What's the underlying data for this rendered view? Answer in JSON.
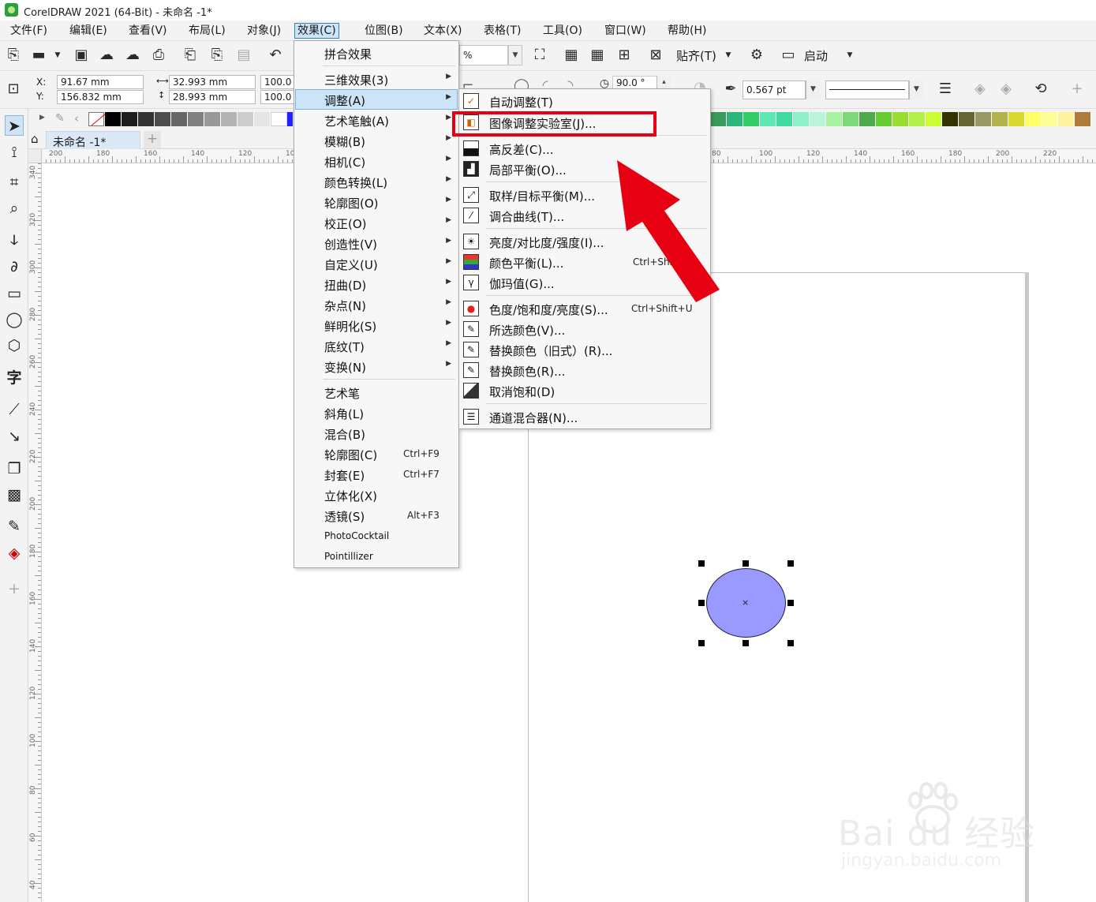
{
  "window": {
    "title": "CorelDRAW 2021 (64-Bit) - 未命名 -1*"
  },
  "menubar": {
    "items": [
      "文件(F)",
      "编辑(E)",
      "查看(V)",
      "布局(L)",
      "对象(J)",
      "效果(C)",
      "位图(B)",
      "文本(X)",
      "表格(T)",
      "工具(O)",
      "窗口(W)",
      "帮助(H)"
    ],
    "active": "效果(C)"
  },
  "toolbar": {
    "zoom_suffix": "%",
    "snap_label": "贴齐(T)",
    "launch_label": "启动"
  },
  "propbar": {
    "x_label": "X:",
    "x_value": "91.67 mm",
    "y_label": "Y:",
    "y_value": "156.832 mm",
    "w_value": "32.993 mm",
    "h_value": "28.993 mm",
    "scale_w": "100.0",
    "scale_h": "100.0",
    "angle_value": "90.0 °",
    "outline_width": "0.567 pt"
  },
  "doc_tab": {
    "label": "未命名 -1*"
  },
  "hruler_labels": [
    "200",
    "180",
    "160",
    "140",
    "120",
    "10",
    "80",
    "100",
    "120",
    "140",
    "160",
    "180",
    "200",
    "220"
  ],
  "vruler_labels": [
    "340",
    "320",
    "300",
    "280",
    "260",
    "240",
    "220",
    "200",
    "180",
    "160",
    "140",
    "120",
    "100",
    "80",
    "60",
    "40"
  ],
  "effects_menu": {
    "items": [
      {
        "label": "拼合效果",
        "shortcut": "",
        "submenu": false
      },
      {
        "label": "三维效果(3)",
        "shortcut": "",
        "submenu": true
      },
      {
        "label": "调整(A)",
        "shortcut": "",
        "submenu": true
      },
      {
        "label": "艺术笔触(A)",
        "shortcut": "",
        "submenu": true
      },
      {
        "label": "模糊(B)",
        "shortcut": "",
        "submenu": true
      },
      {
        "label": "相机(C)",
        "shortcut": "",
        "submenu": true
      },
      {
        "label": "颜色转换(L)",
        "shortcut": "",
        "submenu": true
      },
      {
        "label": "轮廓图(O)",
        "shortcut": "",
        "submenu": true
      },
      {
        "label": "校正(O)",
        "shortcut": "",
        "submenu": true
      },
      {
        "label": "创造性(V)",
        "shortcut": "",
        "submenu": true
      },
      {
        "label": "自定义(U)",
        "shortcut": "",
        "submenu": true
      },
      {
        "label": "扭曲(D)",
        "shortcut": "",
        "submenu": true
      },
      {
        "label": "杂点(N)",
        "shortcut": "",
        "submenu": true
      },
      {
        "label": "鲜明化(S)",
        "shortcut": "",
        "submenu": true
      },
      {
        "label": "底纹(T)",
        "shortcut": "",
        "submenu": true
      },
      {
        "label": "变换(N)",
        "shortcut": "",
        "submenu": true
      },
      {
        "label": "艺术笔",
        "shortcut": "",
        "submenu": false
      },
      {
        "label": "斜角(L)",
        "shortcut": "",
        "submenu": false
      },
      {
        "label": "混合(B)",
        "shortcut": "",
        "submenu": false
      },
      {
        "label": "轮廓图(C)",
        "shortcut": "Ctrl+F9",
        "submenu": false
      },
      {
        "label": "封套(E)",
        "shortcut": "Ctrl+F7",
        "submenu": false
      },
      {
        "label": "立体化(X)",
        "shortcut": "",
        "submenu": false
      },
      {
        "label": "透镜(S)",
        "shortcut": "Alt+F3",
        "submenu": false
      },
      {
        "label": "PhotoCocktail",
        "shortcut": "",
        "submenu": false
      },
      {
        "label": "Pointillizer",
        "shortcut": "",
        "submenu": false
      }
    ],
    "highlighted": "调整(A)"
  },
  "adjust_menu": {
    "items": [
      {
        "label": "自动调整(T)",
        "shortcut": "",
        "icon": "auto-adjust-icon"
      },
      {
        "label": "图像调整实验室(J)...",
        "shortcut": "",
        "icon": "image-adjust-lab-icon"
      },
      {
        "label": "高反差(C)...",
        "shortcut": "",
        "icon": "high-contrast-icon"
      },
      {
        "label": "局部平衡(O)...",
        "shortcut": "",
        "icon": "local-equalize-icon"
      },
      {
        "label": "取样/目标平衡(M)...",
        "shortcut": "",
        "icon": "sample-target-icon"
      },
      {
        "label": "调合曲线(T)...",
        "shortcut": "",
        "icon": "tone-curve-icon"
      },
      {
        "label": "亮度/对比度/强度(I)...",
        "shortcut": "",
        "icon": "brightness-icon"
      },
      {
        "label": "颜色平衡(L)...",
        "shortcut": "Ctrl+Shift",
        "icon": "color-balance-icon"
      },
      {
        "label": "伽玛值(G)...",
        "shortcut": "",
        "icon": "gamma-icon"
      },
      {
        "label": "色度/饱和度/亮度(S)...",
        "shortcut": "Ctrl+Shift+U",
        "icon": "hsl-icon"
      },
      {
        "label": "所选颜色(V)...",
        "shortcut": "",
        "icon": "selective-color-icon"
      },
      {
        "label": "替换颜色（旧式）(R)...",
        "shortcut": "",
        "icon": "replace-color-legacy-icon"
      },
      {
        "label": "替换颜色(R)...",
        "shortcut": "",
        "icon": "replace-color-icon"
      },
      {
        "label": "取消饱和(D)",
        "shortcut": "",
        "icon": "desaturate-icon"
      },
      {
        "label": "通道混合器(N)...",
        "shortcut": "",
        "icon": "channel-mixer-icon"
      }
    ],
    "highlighted": "图像调整实验室(J)..."
  },
  "ellipse": {
    "fill": "#9999ff",
    "center_mark": "×"
  },
  "watermark": {
    "main": "Bai du 经验",
    "sub": "jingyan.baidu.com"
  },
  "colors": {
    "highlight_red": "#e60012",
    "menu_highlight": "#cce4f7",
    "ellipse_fill": "#9999ff"
  }
}
